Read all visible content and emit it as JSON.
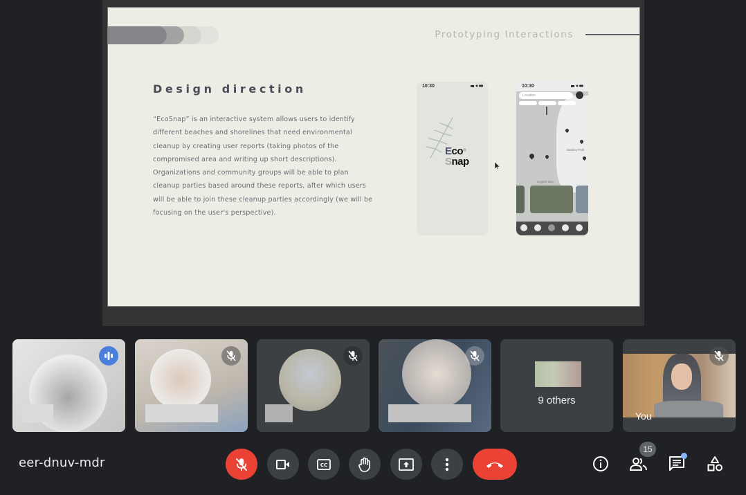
{
  "presentation": {
    "slide": {
      "topic": "Prototyping Interactions",
      "heading": "Design direction",
      "body": "“EcoSnap” is an interactive system allows users to identify different beaches and shorelines that need environmental cleanup by creating user reports (taking photos of the compromised area and writing up short descriptions). Organizations and community groups will be able to plan cleanup parties based around these reports, after which users will be able to join these cleanup parties accordingly (we will be focusing on the user’s perspective).",
      "progress_pills": 4,
      "phone_splash": {
        "time": "10:30",
        "logo_line1": "Eco",
        "logo_line2": "Snap"
      },
      "phone_map": {
        "time": "10:30",
        "search_placeholder": "Location",
        "labels": [
          "Stanley Park",
          "English Bay"
        ]
      }
    }
  },
  "participants": [
    {
      "id": "speaker",
      "state": "speaking",
      "speaking_color": "#4a7fdc"
    },
    {
      "id": "participant-2",
      "state": "muted"
    },
    {
      "id": "participant-3",
      "state": "muted"
    },
    {
      "id": "participant-4",
      "state": "muted"
    },
    {
      "id": "others",
      "label": "9 others"
    },
    {
      "id": "self",
      "label": "You",
      "state": "muted"
    }
  ],
  "bottom_bar": {
    "meeting_code": "eer-dnuv-mdr",
    "controls": [
      {
        "name": "microphone-toggle",
        "icon": "mic-off-icon",
        "state": "off",
        "color": "#ea4335"
      },
      {
        "name": "camera-toggle",
        "icon": "videocam-icon"
      },
      {
        "name": "captions-toggle",
        "icon": "closed-caption-icon"
      },
      {
        "name": "raise-hand",
        "icon": "hand-icon"
      },
      {
        "name": "present-now",
        "icon": "present-screen-icon"
      },
      {
        "name": "more-options",
        "icon": "more-vert-icon"
      },
      {
        "name": "leave-call",
        "icon": "call-end-icon",
        "color": "#ea4335"
      }
    ],
    "right": {
      "participant_count": "15",
      "chat_unread": true
    }
  }
}
